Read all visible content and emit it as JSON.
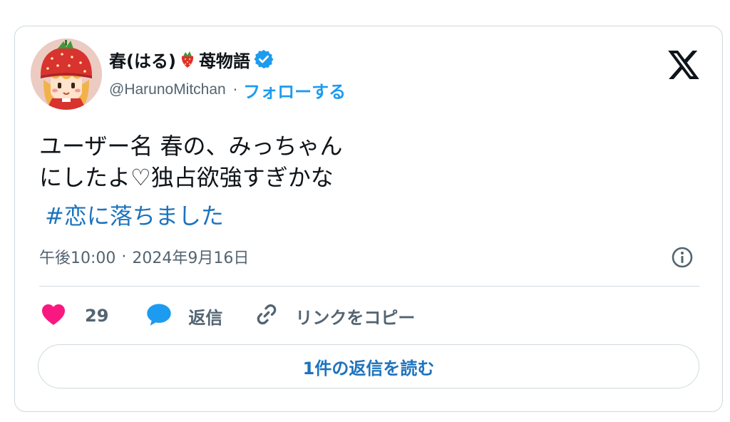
{
  "author": {
    "display_name_prefix": "春(はる)",
    "display_name_suffix": "苺物語",
    "handle": "@HarunoMitchan",
    "separator": "·",
    "follow_label": "フォローする",
    "avatar_icon": "strawberry-hat-girl-avatar",
    "name_glyph_icon": "strawberry-icon",
    "verified_icon": "verified-badge-icon",
    "verified_color": "#1d9bf0"
  },
  "post": {
    "line1": "ユーザー名 春の、みっちゃん",
    "line2": "にしたよ♡独占欲強すぎかな",
    "hashtag": "#恋に落ちました",
    "time": "午後10:00",
    "date_separator": "·",
    "date": "2024年9月16日"
  },
  "actions": {
    "like_count": "29",
    "like_color": "#f91880",
    "reply_label": "返信",
    "reply_color": "#1d9bf0",
    "copy_label": "リンクをコピー"
  },
  "read_replies_label": "1件の返信を読む",
  "icons": {
    "brand": "x-logo-icon",
    "info": "info-icon",
    "like": "heart-icon",
    "reply": "speech-bubble-icon",
    "copy": "link-icon"
  },
  "colors": {
    "link": "#1d73bd",
    "secondary_text": "#536471",
    "border": "#cfd9de"
  }
}
